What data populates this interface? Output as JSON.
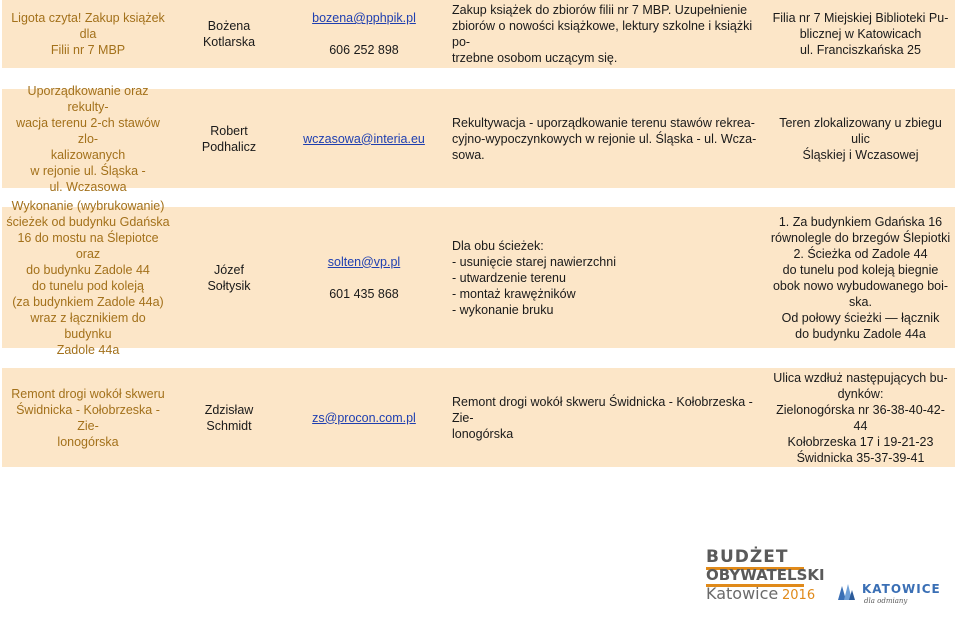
{
  "rows": [
    {
      "name": "Ligota czyta! Zakup książek dla\nFilii nr 7 MBP",
      "person": "Bożena\nKotlarska",
      "email": "bozena@pphpik.pl",
      "phone": "606 252 898",
      "description": "Zakup książek do zbiorów filii nr 7 MBP. Uzupełnienie\nzbiorów o nowości książkowe, lektury szkolne i książki po-\ntrzebne osobom uczącym się.",
      "location": "Filia nr 7 Miejskiej Biblioteki Pu-\nblicznej w Katowicach\nul. Franciszkańska 25"
    },
    {
      "name": "Uporządkowanie oraz rekulty-\nwacja terenu 2-ch stawów zlo-\nkalizowanych\nw rejonie ul. Śląska -\nul. Wczasowa",
      "person": "Robert\nPodhalicz",
      "email": "wczasowa@interia.eu",
      "phone": "",
      "description": "Rekultywacja - uporządkowanie terenu stawów rekrea-\ncyjno-wypoczynkowych w rejonie ul. Śląska - ul. Wcza-\nsowa.",
      "location": "Teren zlokalizowany u zbiegu ulic\nŚląskiej i Wczasowej"
    },
    {
      "name": "Wykonanie (wybrukowanie)\nścieżek od budynku Gdańska\n16 do mostu na Ślepiotce oraz\ndo budynku Zadole 44\ndo tunelu pod koleją\n(za budynkiem Zadole 44a)\nwraz z łącznikiem do budynku\nZadole 44a",
      "person": "Józef\nSołtysik",
      "email": "solten@vp.pl",
      "phone": "601 435 868",
      "description": "Dla obu ścieżek:\n- usunięcie starej nawierzchni\n- utwardzenie terenu\n- montaż krawężników\n- wykonanie bruku",
      "location": "1. Za budynkiem Gdańska 16\nrównolegle do brzegów Ślepiotki\n2. Ścieżka od Zadole 44\ndo tunelu pod koleją biegnie\nobok nowo wybudowanego boi-\nska.\nOd połowy ścieżki — łącznik\ndo budynku Zadole 44a"
    },
    {
      "name": "Remont drogi wokół skweru\nŚwidnicka - Kołobrzeska - Zie-\nlonogórska",
      "person": "Zdzisław\nSchmidt",
      "email": "zs@procon.com.pl",
      "phone": "",
      "description": "Remont drogi wokół skweru Świdnicka - Kołobrzeska - Zie-\nlonogórska",
      "location": "Ulica wzdłuż następujących bu-\ndynków:\nZielonogórska nr 36-38-40-42-44\nKołobrzeska 17 i 19-21-23\nŚwidnicka 35-37-39-41"
    }
  ],
  "logos": {
    "budget_line1": "BUDŻET",
    "budget_line2": "OBYWATELSKI",
    "budget_city": "Katowice",
    "budget_year": "2016",
    "katowice_name": "KATOWICE",
    "katowice_tagline": "dla odmiany"
  },
  "colors": {
    "row_background": "#fce6c8",
    "title_text": "#a3711b",
    "link_text": "#1f3fb0",
    "accent_orange": "#e08a1a",
    "katowice_blue": "#3a6fb5"
  }
}
